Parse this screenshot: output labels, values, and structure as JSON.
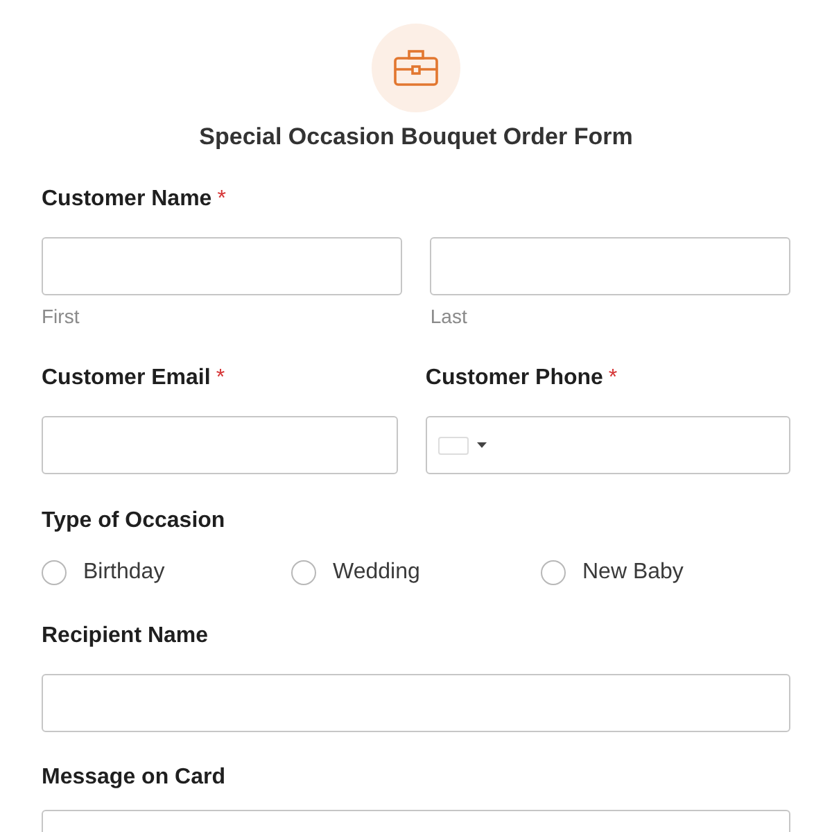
{
  "form": {
    "title": "Special Occasion Bouquet Order Form"
  },
  "rows": [
    {
      "kind": "pair",
      "label": "Customer Name",
      "required_mark": "*",
      "sublabels": [
        "First",
        "Last"
      ]
    },
    {
      "kind": "split",
      "fields": [
        {
          "kind": "text",
          "label": "Customer Email",
          "required_mark": "*"
        },
        {
          "kind": "phone",
          "label": "Customer Phone",
          "required_mark": "*"
        }
      ]
    },
    {
      "kind": "radio",
      "label": "Type of Occasion",
      "options": [
        {
          "label": "Birthday",
          "selected": false
        },
        {
          "label": "Wedding",
          "selected": false
        },
        {
          "label": "New Baby",
          "selected": false
        }
      ]
    },
    {
      "kind": "text",
      "label": "Recipient Name"
    },
    {
      "kind": "textarea",
      "label": "Message on Card"
    }
  ]
}
